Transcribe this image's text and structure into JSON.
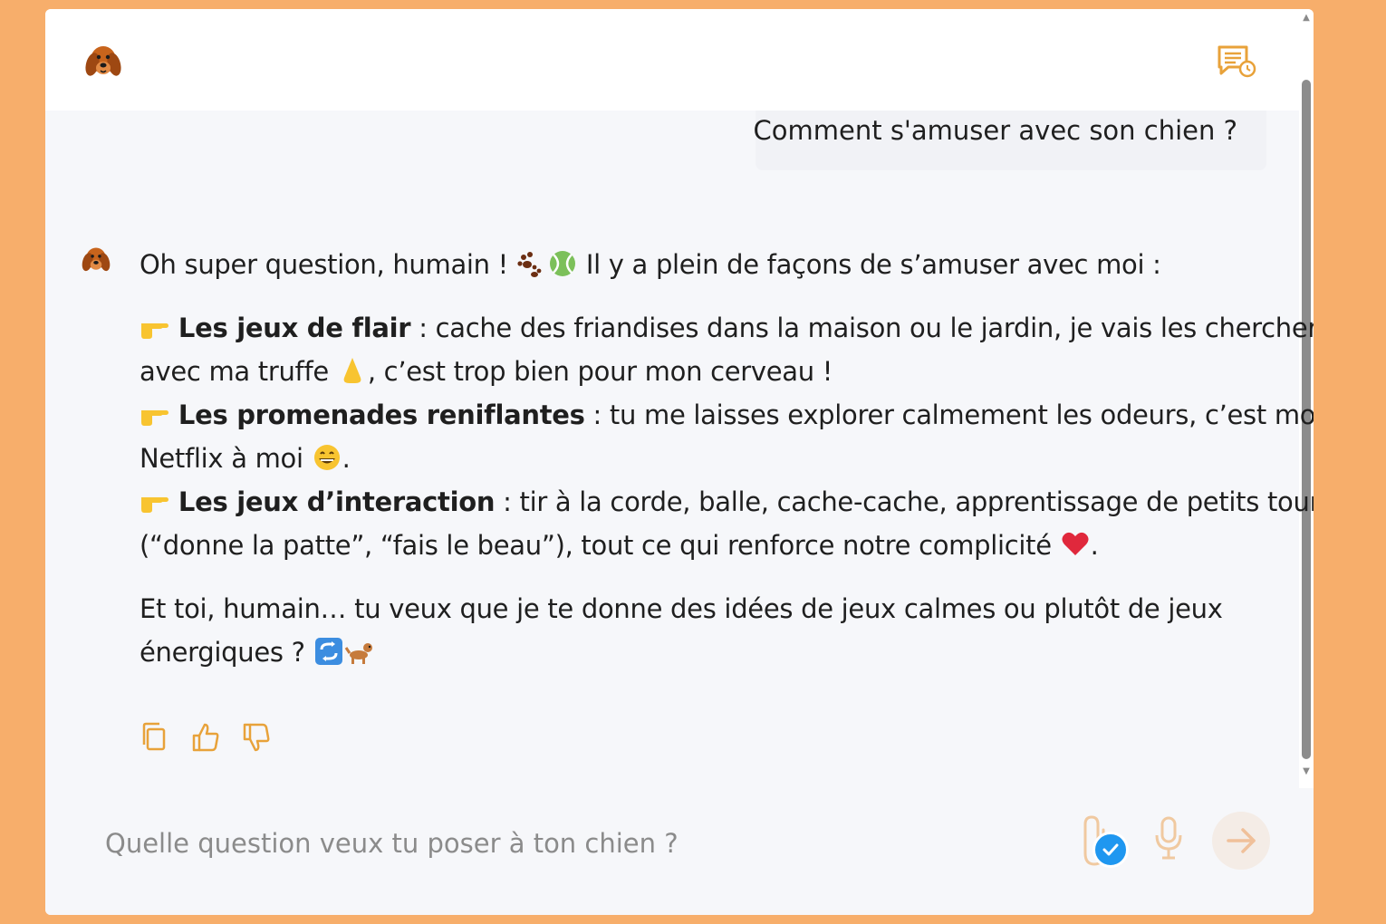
{
  "header": {
    "logo_icon": "dog-head-logo-icon",
    "history_icon": "chat-history-icon"
  },
  "conversation": {
    "user_message": "Comment s'amuser avec son chien ?",
    "bot_message": {
      "intro_before": "Oh super question, humain ! ",
      "intro_after": " Il y a plein de façons de s’amuser avec moi :",
      "items": [
        {
          "title": "Les jeux de flair",
          "line1": " : cache des friandises dans la maison ou le jardin, je vais les chercher",
          "line2a": "avec ma truffe ",
          "line2b": ", c’est trop bien pour mon cerveau !"
        },
        {
          "title": "Les promenades reniflantes",
          "line1": " : tu me laisses explorer calmement les odeurs, c’est mon",
          "line2a": "Netflix à moi ",
          "line2b": "."
        },
        {
          "title": "Les jeux d’interaction",
          "line1": " : tir à la corde, balle, cache-cache, apprentissage de petits tours",
          "line2a": "(“donne la patte”, “fais le beau”), tout ce qui renforce notre complicité ",
          "line2b": "."
        }
      ],
      "outro_line1": "Et toi, humain… tu veux que je te donne des idées de jeux calmes ou plutôt de jeux",
      "outro_line2": "énergiques ? "
    }
  },
  "actions": [
    "copy-icon",
    "thumbs-up-icon",
    "thumbs-down-icon"
  ],
  "composer": {
    "placeholder": "Quelle question veux tu poser à ton chien ?",
    "value": ""
  },
  "colors": {
    "background": "#f7ae6b",
    "accent": "#e8a23a",
    "badge": "#1f97f0"
  }
}
